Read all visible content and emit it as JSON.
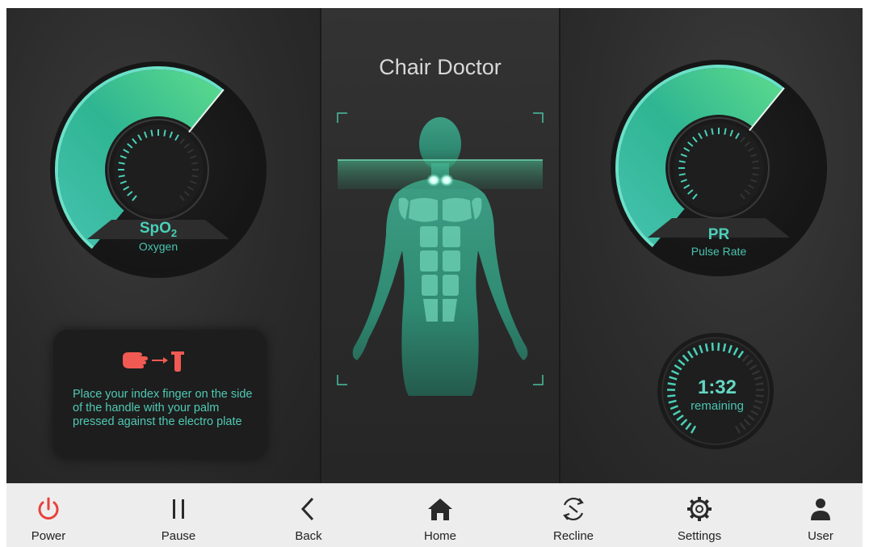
{
  "panels": {
    "left": {
      "gauge": {
        "title": "SpO",
        "subscript": "2",
        "subtitle": "Oxygen",
        "level": 0.64
      },
      "instruction": {
        "icon": "hand-to-handle-icon",
        "text": "Place your index finger on the side of the handle with your palm pressed against the electro plate"
      }
    },
    "center": {
      "title": "Chair Doctor",
      "figure": "body-scan-figure"
    },
    "right": {
      "gauge": {
        "title": "PR",
        "subtitle": "Pulse Rate",
        "level": 0.64
      },
      "timer": {
        "value": "1:32",
        "label": "remaining",
        "progress": 0.62
      }
    }
  },
  "navbar": {
    "items": [
      {
        "key": "power",
        "label": "Power",
        "icon": "power-icon",
        "color": "#e8413a"
      },
      {
        "key": "pause",
        "label": "Pause",
        "icon": "pause-icon",
        "color": "#2a2a2a"
      },
      {
        "key": "back",
        "label": "Back",
        "icon": "chevron-left-icon",
        "color": "#2a2a2a"
      },
      {
        "key": "home",
        "label": "Home",
        "icon": "home-icon",
        "color": "#2a2a2a"
      },
      {
        "key": "recline",
        "label": "Recline",
        "icon": "recline-icon",
        "color": "#2a2a2a"
      },
      {
        "key": "settings",
        "label": "Settings",
        "icon": "gear-icon",
        "color": "#2a2a2a"
      },
      {
        "key": "user",
        "label": "User",
        "icon": "user-icon",
        "color": "#2a2a2a"
      }
    ]
  },
  "colors": {
    "accent": "#4ad0b8",
    "accent_bright": "#5fd98a",
    "background": "#262626",
    "nav_bg": "#ededed",
    "power": "#e8413a"
  }
}
